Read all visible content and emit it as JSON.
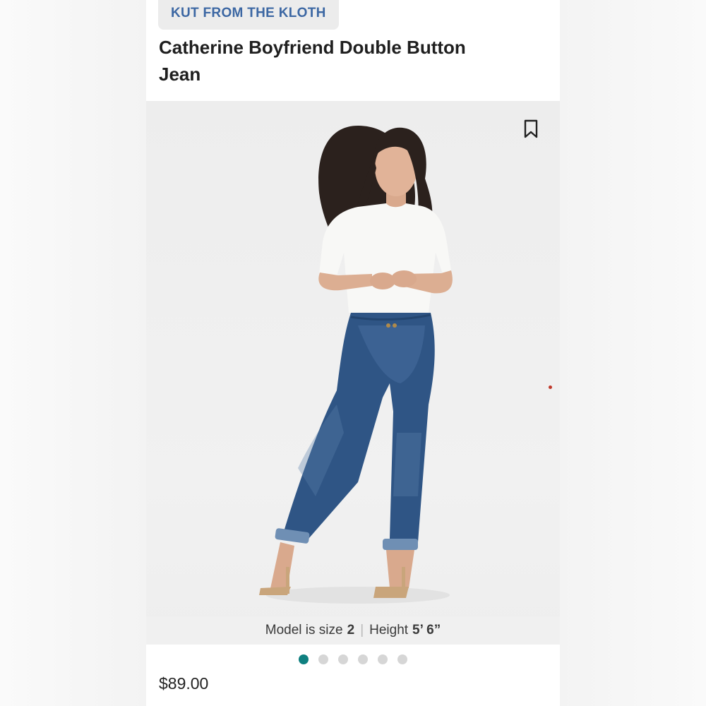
{
  "brand": "KUT FROM THE KLOTH",
  "product_title": "Catherine Boyfriend Double Button Jean",
  "model_info": {
    "prefix": "Model is size",
    "size": "2",
    "separator": "|",
    "height_label": "Height",
    "height": "5’ 6”"
  },
  "carousel": {
    "count": 6,
    "active_index": 0
  },
  "price": "$89.00",
  "icons": {
    "bookmark": "bookmark-icon"
  },
  "colors": {
    "brand_blue": "#3c67a3",
    "carousel_active": "#0f8080",
    "denim": "#2f5585"
  }
}
